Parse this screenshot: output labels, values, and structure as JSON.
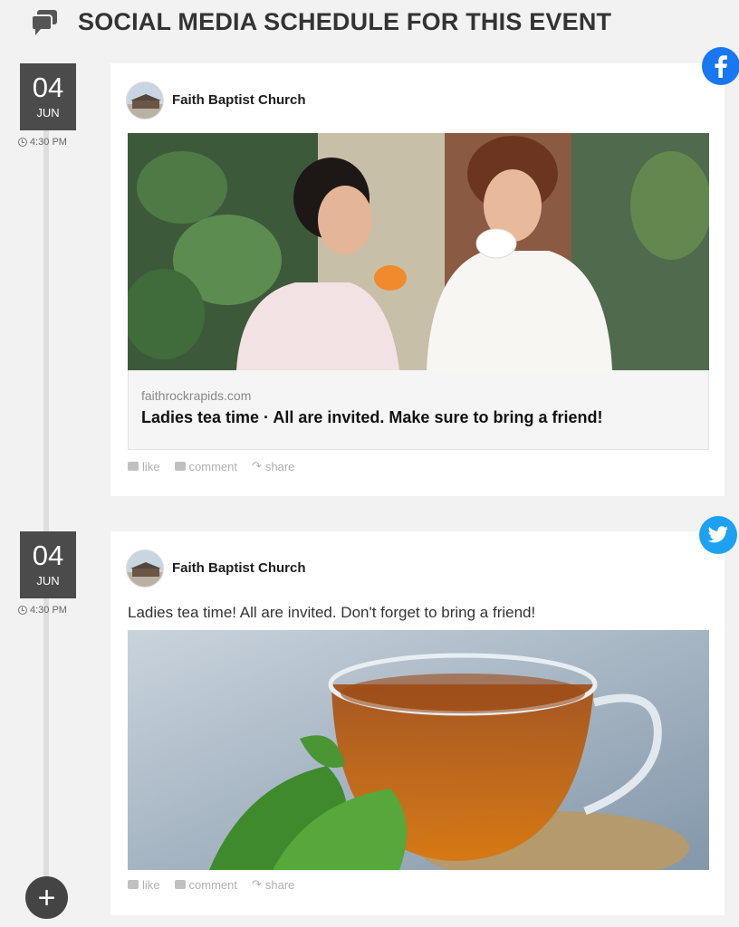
{
  "header": {
    "title": "SOCIAL MEDIA SCHEDULE FOR THIS EVENT",
    "icon": "chat-bubbles-icon"
  },
  "posts": [
    {
      "network": "facebook",
      "network_color": "#1877f2",
      "date": {
        "day": "04",
        "month": "JUN",
        "time": "4:30 PM"
      },
      "page_name": "Faith Baptist Church",
      "link": {
        "domain": "faithrockrapids.com",
        "headline": "Ladies tea time · All are invited. Make sure to bring a friend!"
      },
      "actions": {
        "like": "like",
        "comment": "comment",
        "share": "share"
      }
    },
    {
      "network": "twitter",
      "network_color": "#1da1f2",
      "date": {
        "day": "04",
        "month": "JUN",
        "time": "4:30 PM"
      },
      "page_name": "Faith Baptist Church",
      "text": "Ladies tea time! All are invited. Don't forget to bring a friend!",
      "actions": {
        "like": "like",
        "comment": "comment",
        "share": "share"
      }
    }
  ],
  "add_button": {
    "label": "+"
  }
}
